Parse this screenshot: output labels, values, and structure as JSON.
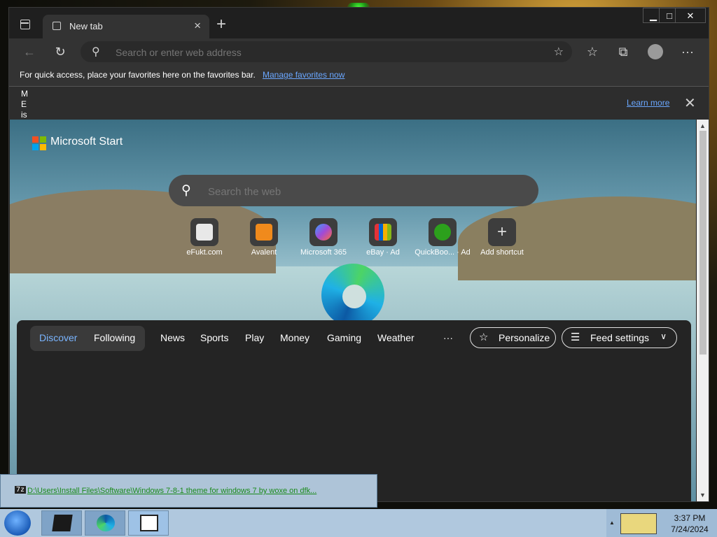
{
  "browser": {
    "tab": {
      "label": "New tab"
    },
    "address_placeholder": "Search or enter web address",
    "favorites_bar": {
      "message": "For quick access, place your favorites here on the favorites bar.",
      "link": "Manage favorites now"
    },
    "infobar": {
      "truncated_lines": [
        "M",
        "E",
        "is"
      ],
      "learn_more": "Learn more"
    }
  },
  "newtab": {
    "brand": "Microsoft Start",
    "search_placeholder": "Search the web",
    "shortcuts": [
      {
        "label": "eFukt.com"
      },
      {
        "label": "Avalent"
      },
      {
        "label": "Microsoft 365"
      },
      {
        "label": "eBay · Ad"
      },
      {
        "label": "QuickBoo... · Ad"
      },
      {
        "label": "Add shortcut"
      }
    ],
    "feed": {
      "segment": [
        "Discover",
        "Following"
      ],
      "tabs": [
        "News",
        "Sports",
        "Play",
        "Money",
        "Gaming",
        "Weather"
      ],
      "more": "···",
      "personalize": "Personalize",
      "feed_settings": "Feed settings"
    }
  },
  "taskbar": {
    "time": "3:37 PM",
    "date": "7/24/2024",
    "preview_text": "D:\\Users\\Install Files\\Software\\Windows 7-8-1 theme for windows 7 by woxe on dfk..."
  }
}
